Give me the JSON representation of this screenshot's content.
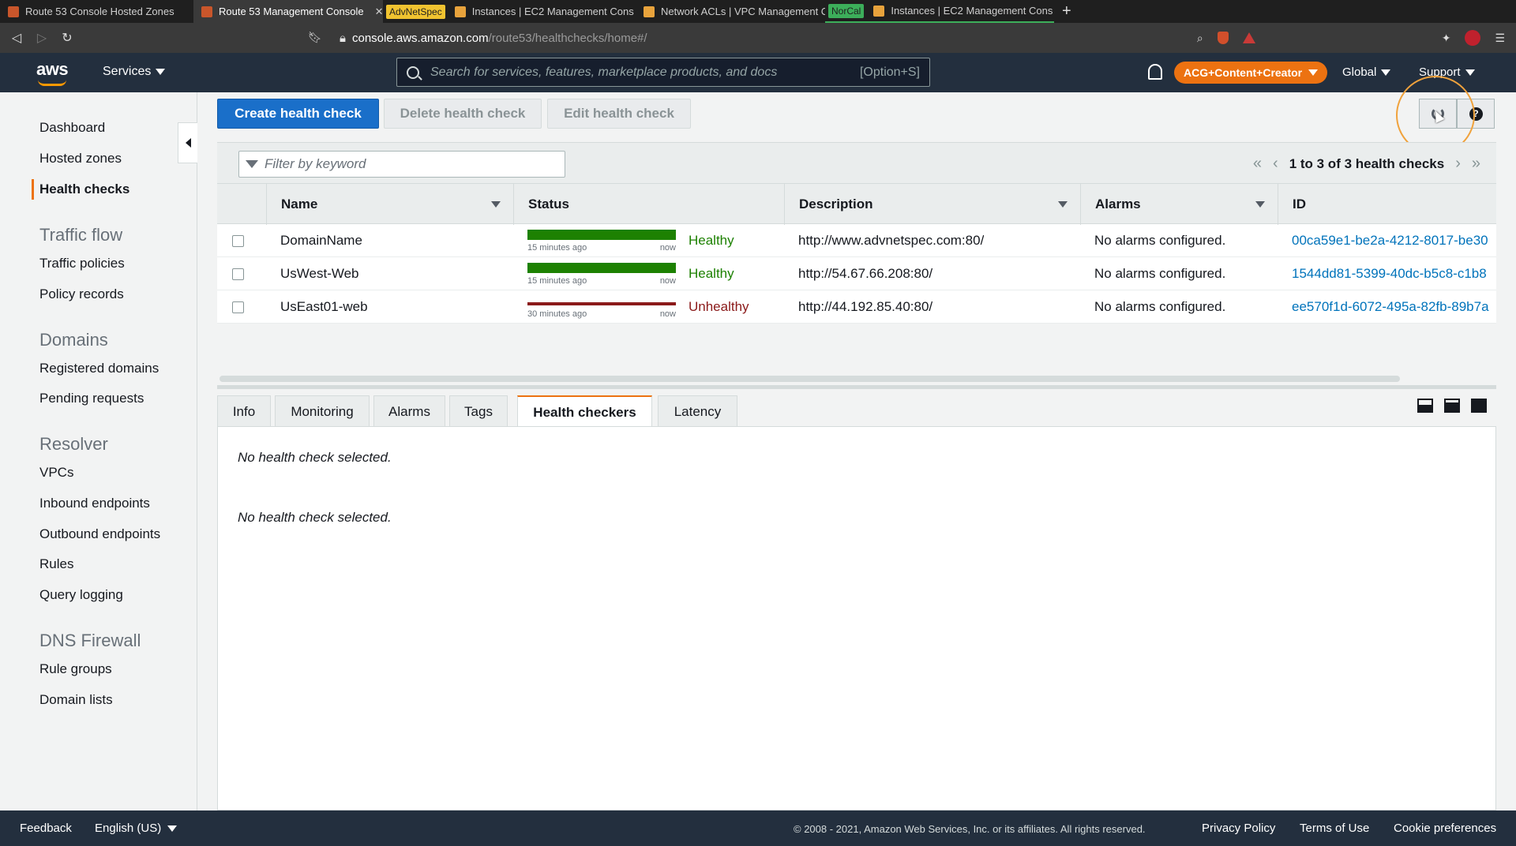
{
  "browser": {
    "tabs": [
      {
        "title": "Route 53 Console Hosted Zones",
        "tag": "",
        "active": false
      },
      {
        "title": "Route 53 Management Console",
        "tag": "",
        "active": true
      },
      {
        "title": "Instances | EC2 Management Cons",
        "tag": "AdvNetSpec",
        "active": false
      },
      {
        "title": "Network ACLs | VPC Management C",
        "tag": "",
        "active": false
      },
      {
        "title": "Instances | EC2 Management Cons",
        "tag": "NorCal",
        "active": false
      }
    ],
    "url_host": "console.aws.amazon.com",
    "url_path": "/route53/healthchecks/home#/"
  },
  "header": {
    "logo": "aws",
    "services": "Services",
    "search_placeholder": "Search for services, features, marketplace products, and docs",
    "search_shortcut": "[Option+S]",
    "account": "ACG+Content+Creator",
    "region": "Global",
    "support": "Support"
  },
  "sidebar": {
    "items": [
      {
        "label": "Dashboard"
      },
      {
        "label": "Hosted zones"
      },
      {
        "label": "Health checks"
      }
    ],
    "sections": [
      {
        "title": "Traffic flow",
        "items": [
          "Traffic policies",
          "Policy records"
        ]
      },
      {
        "title": "Domains",
        "items": [
          "Registered domains",
          "Pending requests"
        ]
      },
      {
        "title": "Resolver",
        "items": [
          "VPCs",
          "Inbound endpoints",
          "Outbound endpoints",
          "Rules",
          "Query logging"
        ]
      },
      {
        "title": "DNS Firewall",
        "items": [
          "Rule groups",
          "Domain lists"
        ]
      }
    ]
  },
  "toolbar": {
    "create": "Create health check",
    "delete": "Delete health check",
    "edit": "Edit health check"
  },
  "filter": {
    "placeholder": "Filter by keyword",
    "pager": "1 to 3 of 3 health checks"
  },
  "table": {
    "columns": [
      "Name",
      "Status",
      "Description",
      "Alarms",
      "ID"
    ],
    "rows": [
      {
        "name": "DomainName",
        "ago": "15 minutes ago",
        "now": "now",
        "status": "Healthy",
        "description": "http://www.advnetspec.com:80/",
        "alarms": "No alarms configured.",
        "id": "00ca59e1-be2a-4212-8017-be30"
      },
      {
        "name": "UsWest-Web",
        "ago": "15 minutes ago",
        "now": "now",
        "status": "Healthy",
        "description": "http://54.67.66.208:80/",
        "alarms": "No alarms configured.",
        "id": "1544dd81-5399-40dc-b5c8-c1b8"
      },
      {
        "name": "UsEast01-web",
        "ago": "30 minutes ago",
        "now": "now",
        "status": "Unhealthy",
        "description": "http://44.192.85.40:80/",
        "alarms": "No alarms configured.",
        "id": "ee570f1d-6072-495a-82fb-89b7a"
      }
    ]
  },
  "detail_tabs": [
    "Info",
    "Monitoring",
    "Alarms",
    "Tags",
    "Health checkers",
    "Latency"
  ],
  "detail": {
    "msg1": "No health check selected.",
    "msg2": "No health check selected."
  },
  "footer": {
    "feedback": "Feedback",
    "language": "English (US)",
    "copyright": "© 2008 - 2021, Amazon Web Services, Inc. or its affiliates. All rights reserved.",
    "privacy": "Privacy Policy",
    "terms": "Terms of Use",
    "cookies": "Cookie preferences"
  },
  "colors": {
    "primary": "#1a6fc9",
    "healthy": "#1d8102",
    "unhealthy": "#8b1a1a",
    "accent": "#ec7211",
    "nav": "#232f3e"
  }
}
